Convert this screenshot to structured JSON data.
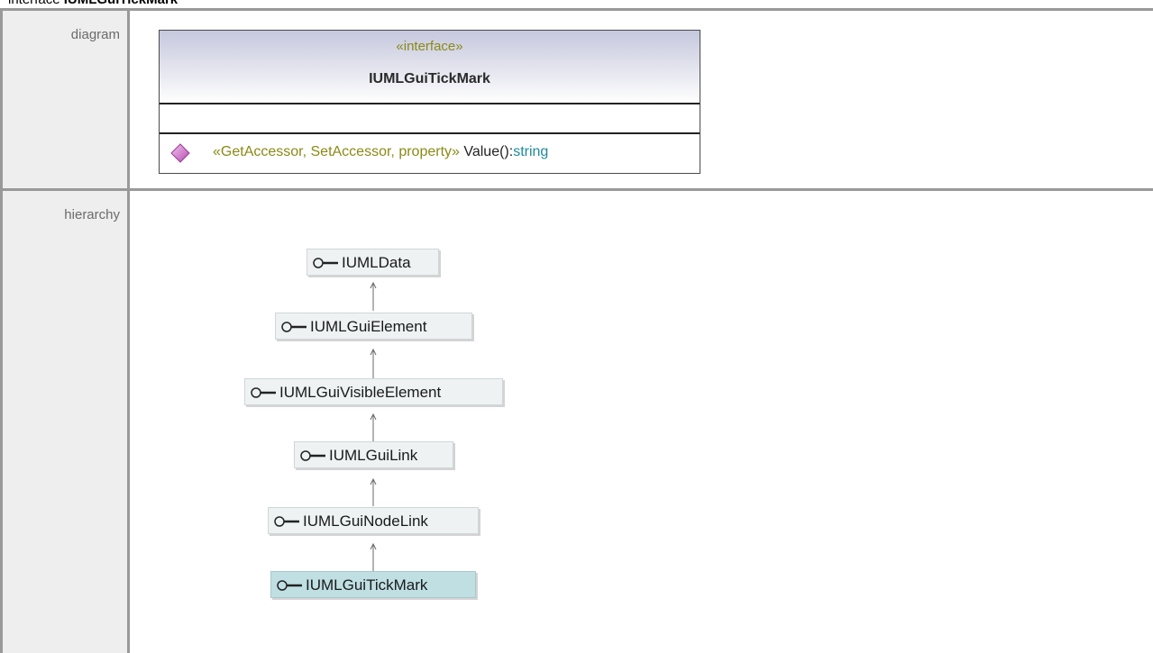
{
  "heading": {
    "prefix": "interface",
    "name": "IUMLGuiTickMark"
  },
  "rows": {
    "diagram_label": "diagram",
    "hierarchy_label": "hierarchy"
  },
  "class_box": {
    "stereotype": "«interface»",
    "name": "IUMLGuiTickMark",
    "operation": {
      "stereotype": "«GetAccessor, SetAccessor, property»",
      "name": "Value():",
      "type": "string",
      "icon": "operation-diamond-icon"
    }
  },
  "hierarchy": {
    "icon": "interface-lollipop-icon",
    "nodes": [
      {
        "label": "IUMLData",
        "selected": false
      },
      {
        "label": "IUMLGuiElement",
        "selected": false
      },
      {
        "label": "IUMLGuiVisibleElement",
        "selected": false
      },
      {
        "label": "IUMLGuiLink",
        "selected": false
      },
      {
        "label": "IUMLGuiNodeLink",
        "selected": false
      },
      {
        "label": "IUMLGuiTickMark",
        "selected": true
      }
    ]
  },
  "colors": {
    "frame": "#999999",
    "label_cell": "#eeeeee",
    "stereotype": "#8a8a16",
    "type": "#1f8a9a",
    "node": "#eef2f3",
    "node_selected": "#bfdfe3",
    "operation_icon": "#cc66cc"
  }
}
